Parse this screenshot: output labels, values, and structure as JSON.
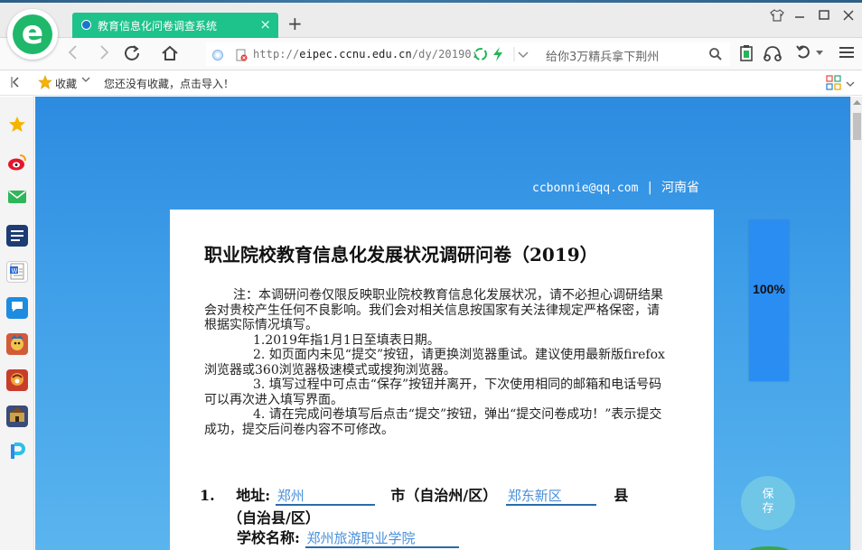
{
  "browser": {
    "tab_title": "教育信息化问卷调查系统",
    "tab_close": "×",
    "new_tab": "+",
    "url_prefix": "http://",
    "url_host": "eipec.ccnu.edu.cn",
    "url_path": "/dy/20190:",
    "search_text": "给你3万精兵拿下荆州",
    "fav_label": "收藏",
    "fav_hint": "您还没有收藏，点击导入！"
  },
  "page": {
    "email": "ccbonnie@qq.com",
    "separator": "|",
    "province": "河南省",
    "title": "职业院校教育信息化发展状况调研问卷（2019）",
    "notes": [
      "注：本调研问卷仅限反映职业院校教育信息化发展状况，请不必担心调研结果会对贵校产生任何不良影响。我们会对相关信息按国家有关法律规定严格保密，请根据实际情况填写。",
      "1.2019年指1月1日至填表日期。",
      "2. 如页面内未见“提交”按钮，请更换浏览器重试。建议使用最新版firefox浏览器或360浏览器极速模式或搜狗浏览器。",
      "3. 填写过程中可点击“保存”按钮并离开，下次使用相同的邮箱和电话号码可以再次进入填写界面。",
      "4. 请在完成问卷填写后点击“提交”按钮，弹出“提交问卷成功！”表示提交成功，提交后问卷内容不可修改。"
    ],
    "q1_number": "1.",
    "q1_address_label": "地址:",
    "q1_city_value": "郑州",
    "q1_city_label": "市（自治州/区）",
    "q1_county_value": "郑东新区",
    "q1_county_label": "县",
    "q1_county_suffix": "（自治县/区）",
    "q1_school_label": "学校名称:",
    "q1_school_value": "郑州旅游职业学院",
    "progress_label": "100%",
    "progress_value": 1.0,
    "save_label": "保存"
  }
}
